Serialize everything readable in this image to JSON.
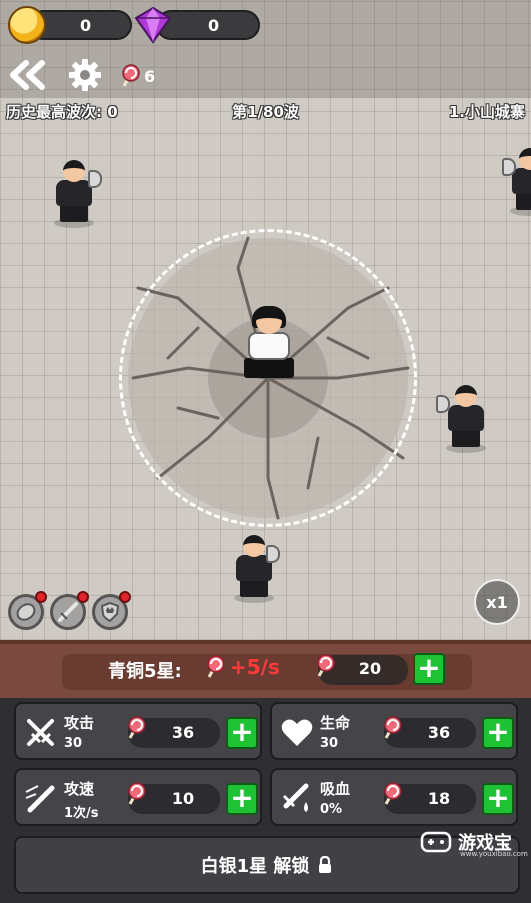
{
  "currency": {
    "coins": "0",
    "gems": "0"
  },
  "toolbar": {
    "lollipops": "6"
  },
  "info": {
    "best_wave": "历史最高波次: 0",
    "wave": "第1/80波",
    "stage": "1.小山城寨"
  },
  "controls": {
    "speed": "x1"
  },
  "upgrade": {
    "rank": "青铜5星:",
    "rate": "+5/s",
    "cost": "20"
  },
  "stats": [
    {
      "name": "攻击",
      "value": "30",
      "cost": "36",
      "icon": "sword-icon"
    },
    {
      "name": "生命",
      "value": "30",
      "cost": "36",
      "icon": "heart-icon"
    },
    {
      "name": "攻速",
      "value": "1次/s",
      "cost": "10",
      "icon": "speed-sword-icon"
    },
    {
      "name": "吸血",
      "value": "0%",
      "cost": "18",
      "icon": "bloodsuck-icon"
    }
  ],
  "unlock": {
    "label": "白银1星 解锁"
  },
  "watermark": {
    "name": "游戏宝",
    "url": "www.youxibao.com"
  },
  "colors": {
    "coin": "#f4b21a",
    "gem": "#b03ad9",
    "plus": "#1ec234",
    "rate": "#ff3a3a",
    "panel": "#7a4a3e"
  }
}
